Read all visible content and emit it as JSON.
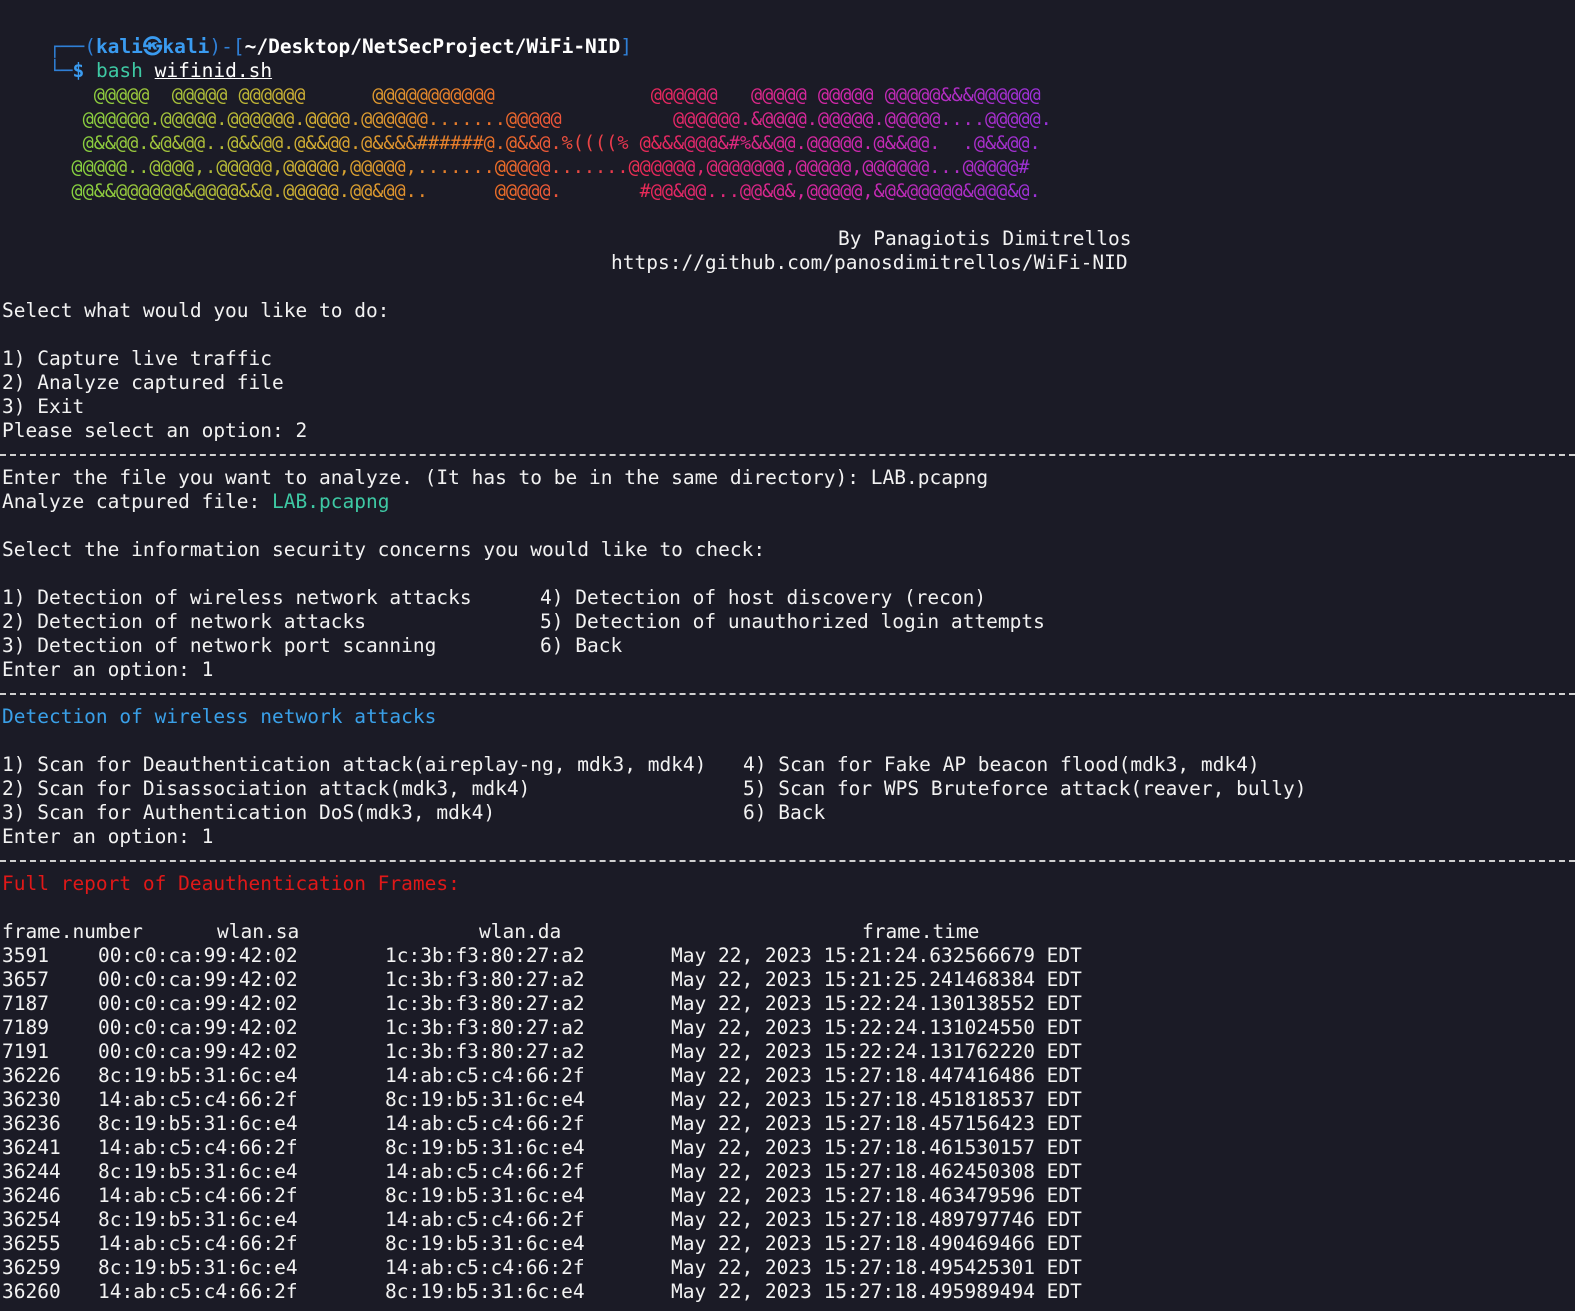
{
  "prompt": {
    "top_prefix": "┌──(",
    "user": "kali㉿kali",
    "mid": ")-[",
    "path": "~/Desktop/NetSecProject/WiFi-NID",
    "end": "]",
    "bottom_prefix": "└─",
    "dollar": "$",
    "command": "bash",
    "script": "wifinid.sh"
  },
  "banner": {
    "art_lines": [
      "     @@@@@  @@@@@ @@@@@@      @@@@@@@@@@@              @@@@@@   @@@@@ @@@@@ @@@@@&&&@@@@@@",
      "    @@@@@@.@@@@@.@@@@@@.@@@@.@@@@@@.......@@@@@          @@@@@@.&@@@@.@@@@@.@@@@@....@@@@@.",
      "    @&&@@.&@&@@..@&&@@.@&&@@.@&&&&######@.@&&@.%((((% @&&&@@@&#%&&@@.@@@@@.@&&@@.  .@&&@@.",
      "   @@@@@..@@@@,.@@@@@,@@@@@,@@@@@,.......@@@@@.......@@@@@@,@@@@@@@,@@@@@,@@@@@@...@@@@@#",
      "   @@&&@@@@@@&@@@@&&@.@@@@@.@@&@@..      @@@@@.       #@@&@@...@@&@&,@@@@@,&@&@@@@@&@@@&@."
    ],
    "author": "By Panagiotis Dimitrellos",
    "url": "https://github.com/panosdimitrellos/WiFi-NID"
  },
  "main_menu": {
    "prompt": "Select what would you like to do:",
    "options": [
      "1) Capture live traffic",
      "2) Analyze captured file",
      "3) Exit"
    ],
    "select_prompt": "Please select an option: 2"
  },
  "file_section": {
    "enter_file": "Enter the file you want to analyze. (It has to be in the same directory): LAB.pcapng",
    "analyze_label": "Analyze catpured file: ",
    "analyze_file": "LAB.pcapng"
  },
  "concerns_menu": {
    "prompt": "Select the information security concerns you would like to check:",
    "left": [
      "1) Detection of wireless network attacks",
      "2) Detection of network attacks",
      "3) Detection of network port scanning"
    ],
    "right": [
      "4) Detection of host discovery (recon)",
      "5) Detection of unauthorized login attempts",
      "6) Back"
    ],
    "enter": "Enter an option: 1"
  },
  "wireless_menu": {
    "title": "Detection of wireless network attacks",
    "left": [
      "1) Scan for Deauthentication attack(aireplay-ng, mdk3, mdk4)",
      "2) Scan for Disassociation attack(mdk3, mdk4)",
      "3) Scan for Authentication DoS(mdk3, mdk4)"
    ],
    "right": [
      "4) Scan for Fake AP beacon flood(mdk3, mdk4)",
      "5) Scan for WPS Bruteforce attack(reaver, bully)",
      "6) Back"
    ],
    "enter": "Enter an option: 1"
  },
  "report": {
    "title": "Full report of Deauthentication Frames:",
    "headers": [
      "frame.number",
      "wlan.sa",
      "wlan.da",
      "frame.time"
    ],
    "rows": [
      [
        "3591",
        "00:c0:ca:99:42:02",
        "1c:3b:f3:80:27:a2",
        "May 22, 2023 15:21:24.632566679 EDT"
      ],
      [
        "3657",
        "00:c0:ca:99:42:02",
        "1c:3b:f3:80:27:a2",
        "May 22, 2023 15:21:25.241468384 EDT"
      ],
      [
        "7187",
        "00:c0:ca:99:42:02",
        "1c:3b:f3:80:27:a2",
        "May 22, 2023 15:22:24.130138552 EDT"
      ],
      [
        "7189",
        "00:c0:ca:99:42:02",
        "1c:3b:f3:80:27:a2",
        "May 22, 2023 15:22:24.131024550 EDT"
      ],
      [
        "7191",
        "00:c0:ca:99:42:02",
        "1c:3b:f3:80:27:a2",
        "May 22, 2023 15:22:24.131762220 EDT"
      ],
      [
        "36226",
        "8c:19:b5:31:6c:e4",
        "14:ab:c5:c4:66:2f",
        "May 22, 2023 15:27:18.447416486 EDT"
      ],
      [
        "36230",
        "14:ab:c5:c4:66:2f",
        "8c:19:b5:31:6c:e4",
        "May 22, 2023 15:27:18.451818537 EDT"
      ],
      [
        "36236",
        "8c:19:b5:31:6c:e4",
        "14:ab:c5:c4:66:2f",
        "May 22, 2023 15:27:18.457156423 EDT"
      ],
      [
        "36241",
        "14:ab:c5:c4:66:2f",
        "8c:19:b5:31:6c:e4",
        "May 22, 2023 15:27:18.461530157 EDT"
      ],
      [
        "36244",
        "8c:19:b5:31:6c:e4",
        "14:ab:c5:c4:66:2f",
        "May 22, 2023 15:27:18.462450308 EDT"
      ],
      [
        "36246",
        "14:ab:c5:c4:66:2f",
        "8c:19:b5:31:6c:e4",
        "May 22, 2023 15:27:18.463479596 EDT"
      ],
      [
        "36254",
        "8c:19:b5:31:6c:e4",
        "14:ab:c5:c4:66:2f",
        "May 22, 2023 15:27:18.489797746 EDT"
      ],
      [
        "36255",
        "14:ab:c5:c4:66:2f",
        "8c:19:b5:31:6c:e4",
        "May 22, 2023 15:27:18.490469466 EDT"
      ],
      [
        "36259",
        "8c:19:b5:31:6c:e4",
        "14:ab:c5:c4:66:2f",
        "May 22, 2023 15:27:18.495425301 EDT"
      ],
      [
        "36260",
        "14:ab:c5:c4:66:2f",
        "8c:19:b5:31:6c:e4",
        "May 22, 2023 15:27:18.495989494 EDT"
      ]
    ]
  },
  "colors": {
    "background": "#1b1b26",
    "prompt_blue": "#3a9bf0",
    "accent_green": "#3ec9a4",
    "section_blue": "#3aa0e8",
    "report_red": "#e01818"
  }
}
